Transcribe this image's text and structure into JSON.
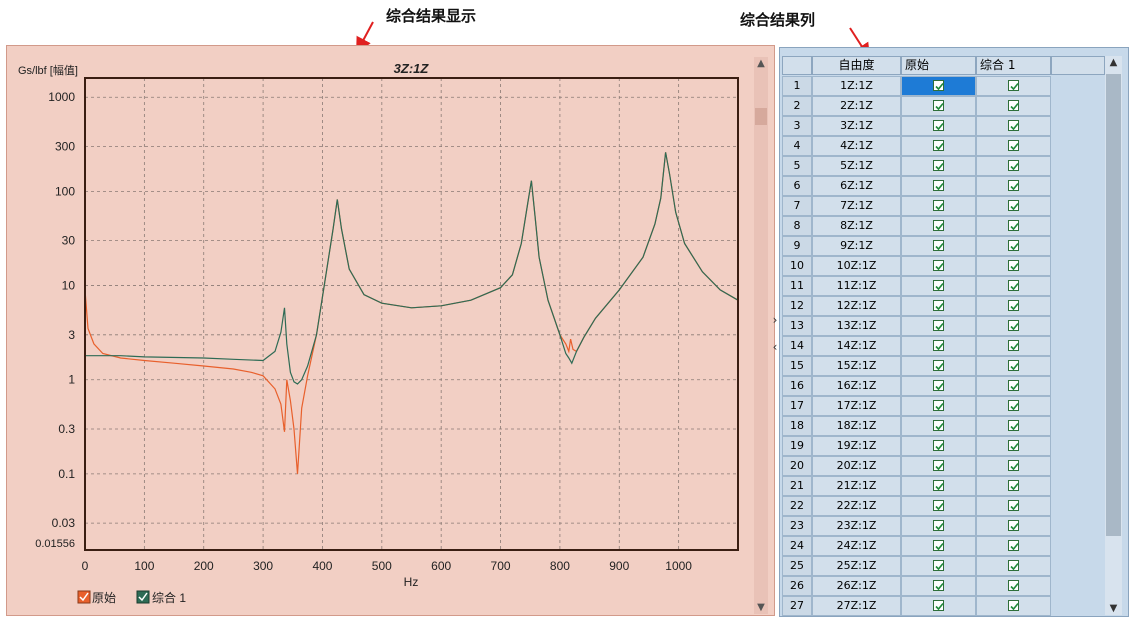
{
  "callouts": {
    "left": "综合结果显示",
    "right": "综合结果列"
  },
  "chart": {
    "title": "3Z:1Z",
    "ylabel": "Gs/lbf [幅值]",
    "xlabel": "Hz",
    "y_ticks": [
      "1000",
      "300",
      "100",
      "30",
      "10",
      "3",
      "1",
      "0.3",
      "0.1",
      "0.03"
    ],
    "y_min_label": "0.01556",
    "x_ticks": [
      "0",
      "100",
      "200",
      "300",
      "400",
      "500",
      "600",
      "700",
      "800",
      "900",
      "1000"
    ],
    "legend": [
      "原始",
      "综合 1"
    ],
    "colors": {
      "original": "#e8602c",
      "synth": "#2e6b55",
      "background": "#f2cfc4"
    }
  },
  "chart_data": {
    "type": "line",
    "title": "3Z:1Z",
    "xlabel": "Hz",
    "ylabel": "Gs/lbf [幅值]",
    "xlim": [
      0,
      1100
    ],
    "ylim": [
      0.01556,
      1600
    ],
    "yscale": "log",
    "grid": true,
    "legend_position": "bottom-left",
    "series": [
      {
        "name": "原始",
        "color": "#e8602c",
        "x": [
          0,
          5,
          15,
          30,
          60,
          100,
          150,
          200,
          250,
          280,
          300,
          320,
          330,
          336,
          340,
          346,
          352,
          358,
          365,
          375,
          390,
          405,
          418,
          425,
          432,
          445,
          470,
          500,
          550,
          600,
          650,
          700,
          720,
          735,
          745,
          752,
          758,
          765,
          780,
          800,
          810,
          815,
          818,
          822,
          828,
          840,
          860,
          900,
          940,
          960,
          970,
          978,
          985,
          995,
          1010,
          1040,
          1070,
          1100
        ],
        "y": [
          9,
          3.5,
          2.4,
          1.9,
          1.7,
          1.6,
          1.5,
          1.4,
          1.3,
          1.2,
          1.1,
          0.8,
          0.55,
          0.28,
          1.0,
          0.6,
          0.3,
          0.1,
          0.5,
          1.1,
          3,
          12,
          40,
          82,
          40,
          15,
          8,
          6.5,
          5.8,
          6.1,
          7,
          9.5,
          13,
          28,
          70,
          130,
          55,
          20,
          7,
          3,
          2.4,
          2.0,
          2.7,
          2.1,
          2.0,
          2.8,
          4.5,
          9,
          20,
          45,
          85,
          260,
          150,
          60,
          28,
          14,
          9,
          7
        ]
      },
      {
        "name": "综合 1",
        "color": "#2e6b55",
        "x": [
          0,
          60,
          100,
          200,
          250,
          300,
          320,
          330,
          336,
          340,
          346,
          352,
          358,
          365,
          375,
          390,
          405,
          418,
          425,
          432,
          445,
          470,
          500,
          550,
          600,
          650,
          700,
          720,
          735,
          745,
          752,
          758,
          765,
          780,
          800,
          810,
          815,
          820,
          828,
          840,
          860,
          900,
          940,
          960,
          970,
          978,
          985,
          995,
          1010,
          1040,
          1070,
          1100
        ],
        "y": [
          1.8,
          1.8,
          1.75,
          1.7,
          1.65,
          1.6,
          2.0,
          3.2,
          5.8,
          2.4,
          1.2,
          0.95,
          0.9,
          1.0,
          1.4,
          3,
          12,
          40,
          82,
          40,
          15,
          8,
          6.5,
          5.8,
          6.1,
          7,
          9.5,
          13,
          28,
          70,
          130,
          55,
          20,
          7,
          3,
          1.9,
          1.7,
          1.5,
          2.0,
          2.8,
          4.5,
          9,
          20,
          45,
          85,
          260,
          150,
          60,
          28,
          14,
          9,
          7
        ]
      }
    ]
  },
  "table": {
    "headers": [
      "自由度",
      "原始",
      "综合 1"
    ],
    "rows": [
      {
        "i": "1",
        "dof": "1Z:1Z"
      },
      {
        "i": "2",
        "dof": "2Z:1Z"
      },
      {
        "i": "3",
        "dof": "3Z:1Z"
      },
      {
        "i": "4",
        "dof": "4Z:1Z"
      },
      {
        "i": "5",
        "dof": "5Z:1Z"
      },
      {
        "i": "6",
        "dof": "6Z:1Z"
      },
      {
        "i": "7",
        "dof": "7Z:1Z"
      },
      {
        "i": "8",
        "dof": "8Z:1Z"
      },
      {
        "i": "9",
        "dof": "9Z:1Z"
      },
      {
        "i": "10",
        "dof": "10Z:1Z"
      },
      {
        "i": "11",
        "dof": "11Z:1Z"
      },
      {
        "i": "12",
        "dof": "12Z:1Z"
      },
      {
        "i": "13",
        "dof": "13Z:1Z"
      },
      {
        "i": "14",
        "dof": "14Z:1Z"
      },
      {
        "i": "15",
        "dof": "15Z:1Z"
      },
      {
        "i": "16",
        "dof": "16Z:1Z"
      },
      {
        "i": "17",
        "dof": "17Z:1Z"
      },
      {
        "i": "18",
        "dof": "18Z:1Z"
      },
      {
        "i": "19",
        "dof": "19Z:1Z"
      },
      {
        "i": "20",
        "dof": "20Z:1Z"
      },
      {
        "i": "21",
        "dof": "21Z:1Z"
      },
      {
        "i": "22",
        "dof": "22Z:1Z"
      },
      {
        "i": "23",
        "dof": "23Z:1Z"
      },
      {
        "i": "24",
        "dof": "24Z:1Z"
      },
      {
        "i": "25",
        "dof": "25Z:1Z"
      },
      {
        "i": "26",
        "dof": "26Z:1Z"
      },
      {
        "i": "27",
        "dof": "27Z:1Z"
      }
    ],
    "selected_row": 1,
    "checked": true
  },
  "icons": {
    "checkbox": "checkbox-checked-icon",
    "scroll_up": "scroll-up-icon",
    "scroll_down": "scroll-down-icon"
  }
}
